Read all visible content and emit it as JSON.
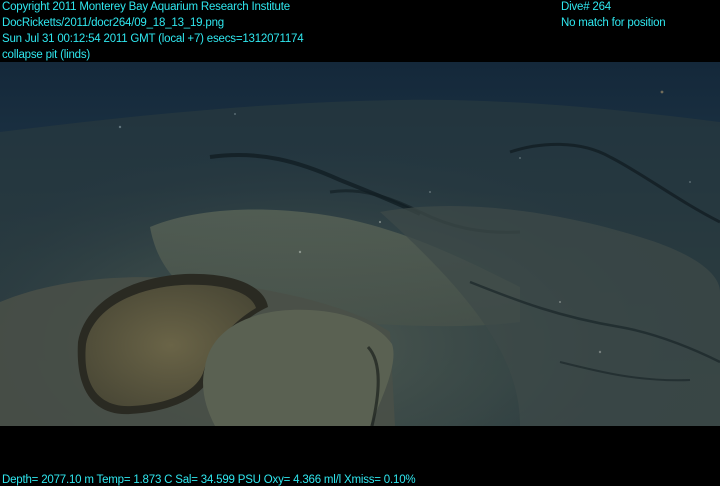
{
  "overlay": {
    "color": "#2fe7ef",
    "header_left": [
      "Copyright 2011 Monterey Bay Aquarium Research Institute",
      "DocRicketts/2011/docr264/09_18_13_19.png",
      "Sun Jul 31 00:12:54 2011 GMT (local +7)  esecs=1312071174",
      "collapse pit (linds)"
    ],
    "header_right": [
      "Dive# 264",
      "No match for position"
    ],
    "footer": "Depth= 2077.10 m  Temp= 1.873 C  Sal= 34.599 PSU  Oxy= 4.366 ml/l  Xmiss= 0.10%"
  },
  "scene": {
    "water_color": "#16293a",
    "seafloor_color": "#4e5a52",
    "pit_floor_color": "#5a553e"
  }
}
